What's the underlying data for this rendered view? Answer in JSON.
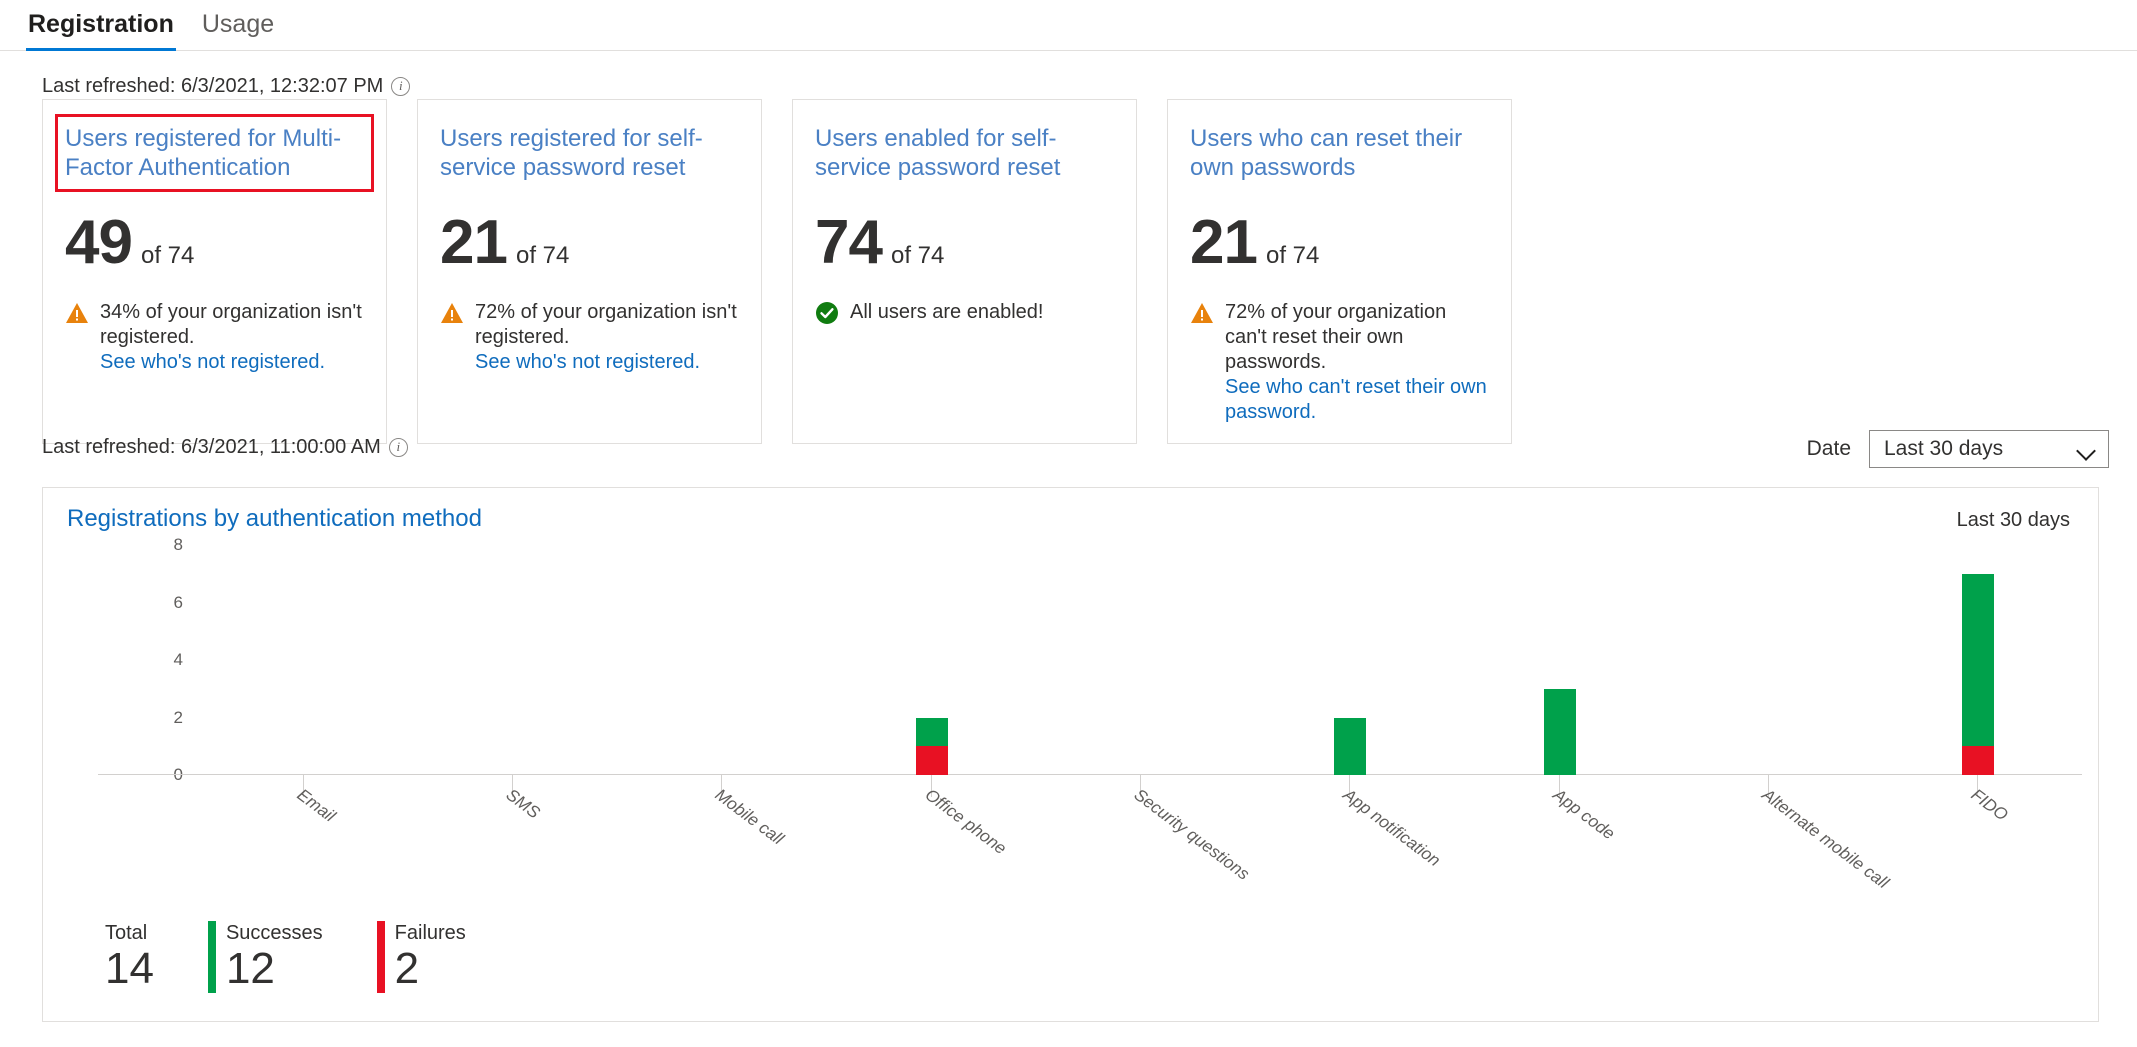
{
  "tabs": [
    {
      "label": "Registration",
      "active": true
    },
    {
      "label": "Usage",
      "active": false
    }
  ],
  "refresh_top": "Last refreshed: 6/3/2021, 12:32:07 PM",
  "refresh_mid": "Last refreshed: 6/3/2021, 11:00:00 AM",
  "cards": [
    {
      "title": "Users registered for Multi-Factor Authentication",
      "value": "49",
      "of": "of 74",
      "status": "warning",
      "note": "34% of your organization isn't registered.",
      "link": "See who's not registered.",
      "highlighted": true
    },
    {
      "title": "Users registered for self-service password reset",
      "value": "21",
      "of": "of 74",
      "status": "warning",
      "note": "72% of your organization isn't registered.",
      "link": "See who's not registered.",
      "highlighted": false
    },
    {
      "title": "Users enabled for self-service password reset",
      "value": "74",
      "of": "of 74",
      "status": "ok",
      "note": "All users are enabled!",
      "link": "",
      "highlighted": false
    },
    {
      "title": "Users who can reset their own passwords",
      "value": "21",
      "of": "of 74",
      "status": "warning",
      "note": "72% of your organization can't reset their own passwords.",
      "link": "See who can't reset their own password.",
      "highlighted": false
    }
  ],
  "date_filter": {
    "label": "Date",
    "value": "Last 30 days"
  },
  "chart_panel": {
    "title": "Registrations by authentication method",
    "range": "Last 30 days"
  },
  "totals": [
    {
      "label": "Total",
      "value": "14",
      "color": ""
    },
    {
      "label": "Successes",
      "value": "12",
      "color": "#00a14b"
    },
    {
      "label": "Failures",
      "value": "2",
      "color": "#e81123"
    }
  ],
  "colors": {
    "accent": "#0078d4",
    "link": "#0f6cbd",
    "success": "#00a14b",
    "failure": "#e81123",
    "warning": "#e8820c",
    "highlight_border": "#e81123"
  },
  "chart_data": {
    "type": "bar",
    "title": "Registrations by authentication method",
    "xlabel": "",
    "ylabel": "",
    "ylim": [
      0,
      8
    ],
    "yticks": [
      0,
      2,
      4,
      6,
      8
    ],
    "grid": false,
    "stacked": true,
    "legend_position": "bottom-left",
    "categories": [
      "Email",
      "SMS",
      "Mobile call",
      "Office phone",
      "Security questions",
      "App notification",
      "App code",
      "Alternate mobile call",
      "FIDO"
    ],
    "series": [
      {
        "name": "Failures",
        "color": "#e81123",
        "values": [
          0,
          0,
          0,
          1,
          0,
          0,
          0,
          0,
          1
        ]
      },
      {
        "name": "Successes",
        "color": "#00a14b",
        "values": [
          0,
          0,
          0,
          1,
          0,
          2,
          3,
          0,
          6
        ]
      }
    ],
    "totals": {
      "Total": 14,
      "Successes": 12,
      "Failures": 2
    }
  }
}
